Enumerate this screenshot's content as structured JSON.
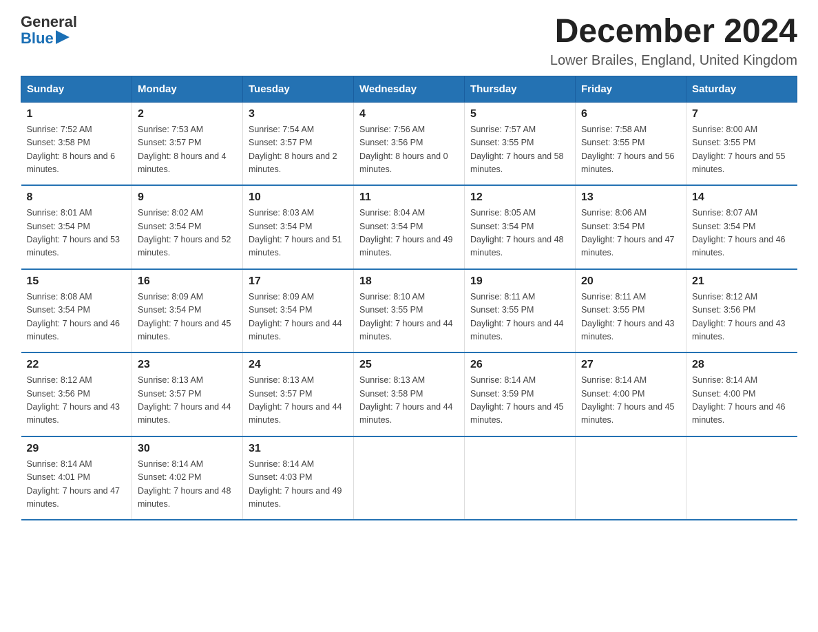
{
  "header": {
    "logo_general": "General",
    "logo_blue": "Blue",
    "month_title": "December 2024",
    "location": "Lower Brailes, England, United Kingdom"
  },
  "weekdays": [
    "Sunday",
    "Monday",
    "Tuesday",
    "Wednesday",
    "Thursday",
    "Friday",
    "Saturday"
  ],
  "weeks": [
    [
      {
        "day": "1",
        "sunrise": "7:52 AM",
        "sunset": "3:58 PM",
        "daylight": "8 hours and 6 minutes."
      },
      {
        "day": "2",
        "sunrise": "7:53 AM",
        "sunset": "3:57 PM",
        "daylight": "8 hours and 4 minutes."
      },
      {
        "day": "3",
        "sunrise": "7:54 AM",
        "sunset": "3:57 PM",
        "daylight": "8 hours and 2 minutes."
      },
      {
        "day": "4",
        "sunrise": "7:56 AM",
        "sunset": "3:56 PM",
        "daylight": "8 hours and 0 minutes."
      },
      {
        "day": "5",
        "sunrise": "7:57 AM",
        "sunset": "3:55 PM",
        "daylight": "7 hours and 58 minutes."
      },
      {
        "day": "6",
        "sunrise": "7:58 AM",
        "sunset": "3:55 PM",
        "daylight": "7 hours and 56 minutes."
      },
      {
        "day": "7",
        "sunrise": "8:00 AM",
        "sunset": "3:55 PM",
        "daylight": "7 hours and 55 minutes."
      }
    ],
    [
      {
        "day": "8",
        "sunrise": "8:01 AM",
        "sunset": "3:54 PM",
        "daylight": "7 hours and 53 minutes."
      },
      {
        "day": "9",
        "sunrise": "8:02 AM",
        "sunset": "3:54 PM",
        "daylight": "7 hours and 52 minutes."
      },
      {
        "day": "10",
        "sunrise": "8:03 AM",
        "sunset": "3:54 PM",
        "daylight": "7 hours and 51 minutes."
      },
      {
        "day": "11",
        "sunrise": "8:04 AM",
        "sunset": "3:54 PM",
        "daylight": "7 hours and 49 minutes."
      },
      {
        "day": "12",
        "sunrise": "8:05 AM",
        "sunset": "3:54 PM",
        "daylight": "7 hours and 48 minutes."
      },
      {
        "day": "13",
        "sunrise": "8:06 AM",
        "sunset": "3:54 PM",
        "daylight": "7 hours and 47 minutes."
      },
      {
        "day": "14",
        "sunrise": "8:07 AM",
        "sunset": "3:54 PM",
        "daylight": "7 hours and 46 minutes."
      }
    ],
    [
      {
        "day": "15",
        "sunrise": "8:08 AM",
        "sunset": "3:54 PM",
        "daylight": "7 hours and 46 minutes."
      },
      {
        "day": "16",
        "sunrise": "8:09 AM",
        "sunset": "3:54 PM",
        "daylight": "7 hours and 45 minutes."
      },
      {
        "day": "17",
        "sunrise": "8:09 AM",
        "sunset": "3:54 PM",
        "daylight": "7 hours and 44 minutes."
      },
      {
        "day": "18",
        "sunrise": "8:10 AM",
        "sunset": "3:55 PM",
        "daylight": "7 hours and 44 minutes."
      },
      {
        "day": "19",
        "sunrise": "8:11 AM",
        "sunset": "3:55 PM",
        "daylight": "7 hours and 44 minutes."
      },
      {
        "day": "20",
        "sunrise": "8:11 AM",
        "sunset": "3:55 PM",
        "daylight": "7 hours and 43 minutes."
      },
      {
        "day": "21",
        "sunrise": "8:12 AM",
        "sunset": "3:56 PM",
        "daylight": "7 hours and 43 minutes."
      }
    ],
    [
      {
        "day": "22",
        "sunrise": "8:12 AM",
        "sunset": "3:56 PM",
        "daylight": "7 hours and 43 minutes."
      },
      {
        "day": "23",
        "sunrise": "8:13 AM",
        "sunset": "3:57 PM",
        "daylight": "7 hours and 44 minutes."
      },
      {
        "day": "24",
        "sunrise": "8:13 AM",
        "sunset": "3:57 PM",
        "daylight": "7 hours and 44 minutes."
      },
      {
        "day": "25",
        "sunrise": "8:13 AM",
        "sunset": "3:58 PM",
        "daylight": "7 hours and 44 minutes."
      },
      {
        "day": "26",
        "sunrise": "8:14 AM",
        "sunset": "3:59 PM",
        "daylight": "7 hours and 45 minutes."
      },
      {
        "day": "27",
        "sunrise": "8:14 AM",
        "sunset": "4:00 PM",
        "daylight": "7 hours and 45 minutes."
      },
      {
        "day": "28",
        "sunrise": "8:14 AM",
        "sunset": "4:00 PM",
        "daylight": "7 hours and 46 minutes."
      }
    ],
    [
      {
        "day": "29",
        "sunrise": "8:14 AM",
        "sunset": "4:01 PM",
        "daylight": "7 hours and 47 minutes."
      },
      {
        "day": "30",
        "sunrise": "8:14 AM",
        "sunset": "4:02 PM",
        "daylight": "7 hours and 48 minutes."
      },
      {
        "day": "31",
        "sunrise": "8:14 AM",
        "sunset": "4:03 PM",
        "daylight": "7 hours and 49 minutes."
      },
      null,
      null,
      null,
      null
    ]
  ]
}
